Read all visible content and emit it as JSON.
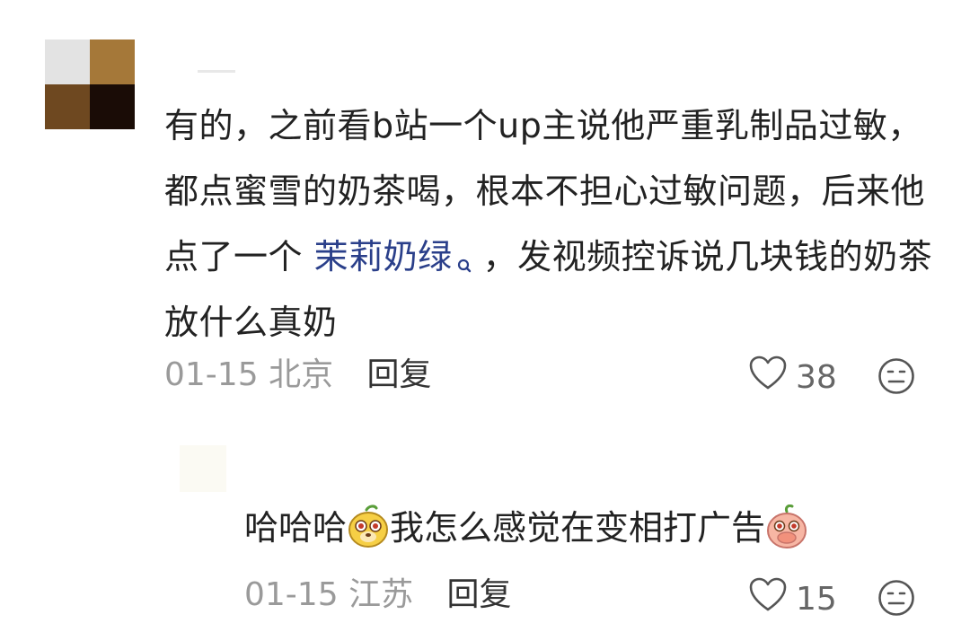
{
  "colors": {
    "avatar_tl": "#e3e3e3",
    "avatar_tr": "#a57839",
    "avatar_bl": "#6e4820",
    "avatar_br": "#1a0c06",
    "link": "#2a3f8a"
  },
  "comment": {
    "text_before_link": "有的，之前看b站一个up主说他严重乳制品过敏，都点蜜雪的奶茶喝，根本不担心过敏问题，后来他点了一个 ",
    "link_text": "茉莉奶绿",
    "link_icon": "search-icon",
    "text_after_link": "，发视频控诉说几块钱的奶茶放什么真奶",
    "date": "01-15",
    "location": "北京",
    "reply_label": "回复",
    "like_icon": "heart-icon",
    "like_count": "38",
    "emoji_icon": "emoji-face-icon"
  },
  "reply": {
    "text_part1": "哈哈哈",
    "sticker1": "bear-face-sticker",
    "text_part2": "我怎么感觉在变相打广告",
    "sticker2": "peach-covering-mouth-sticker",
    "date": "01-15",
    "location": "江苏",
    "reply_label": "回复",
    "like_icon": "heart-icon",
    "like_count": "15",
    "emoji_icon": "emoji-face-icon"
  }
}
